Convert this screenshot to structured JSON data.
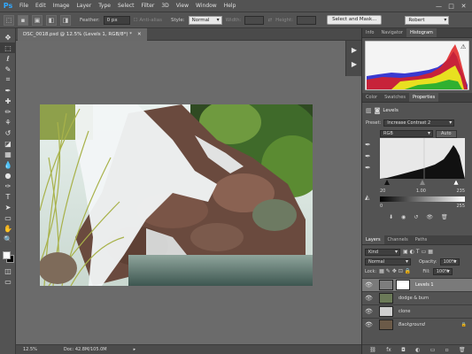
{
  "app": {
    "logo": "Ps"
  },
  "menu": [
    "File",
    "Edit",
    "Image",
    "Layer",
    "Type",
    "Select",
    "Filter",
    "3D",
    "View",
    "Window",
    "Help"
  ],
  "window_controls": [
    "—",
    "□",
    "✕"
  ],
  "options": {
    "feather_label": "Feather:",
    "feather_value": "0 px",
    "anti_alias_label": "Anti-alias",
    "style_label": "Style:",
    "style_value": "Normal",
    "width_label": "Width:",
    "height_label": "Height:",
    "select_mask_label": "Select and Mask...",
    "workspace_value": "Robert"
  },
  "tools": [
    "move-tool",
    "marquee-tool",
    "lasso-tool",
    "quick-select-tool",
    "crop-tool",
    "eyedropper-tool",
    "healing-brush-tool",
    "brush-tool",
    "clone-stamp-tool",
    "history-brush-tool",
    "eraser-tool",
    "gradient-tool",
    "blur-tool",
    "dodge-tool",
    "pen-tool",
    "type-tool",
    "path-select-tool",
    "rectangle-tool",
    "hand-tool",
    "zoom-tool"
  ],
  "tool_glyphs": [
    "✥",
    "⬚",
    "ℓ",
    "✎",
    "⌗",
    "✒",
    "✚",
    "✏",
    "⚘",
    "↺",
    "◪",
    "▦",
    "💧",
    "●",
    "✑",
    "T",
    "➤",
    "▭",
    "✋",
    "🔍"
  ],
  "document": {
    "tab_label": "DSC_0018.psd @ 12.5% (Levels 1, RGB/8*) *",
    "close": "✕"
  },
  "status": {
    "zoom": "12.5%",
    "doc_info": "Doc: 42.8M/105.0M",
    "arrow": "▸"
  },
  "histogram_panel": {
    "tabs": [
      "Info",
      "Navigator",
      "Histogram"
    ],
    "active": 2
  },
  "properties_panel": {
    "tabs": [
      "Color",
      "Swatches",
      "Properties"
    ],
    "active": 2,
    "title": "Levels",
    "preset_label": "Preset:",
    "preset_value": "Increase Contrast 2",
    "channel_value": "RGB",
    "auto_label": "Auto",
    "input_black": "20",
    "input_gray": "1.00",
    "input_white": "235",
    "output_black": "0",
    "output_white": "255"
  },
  "layers_panel": {
    "tabs": [
      "Layers",
      "Channels",
      "Paths"
    ],
    "active": 0,
    "filter_kind": "Kind",
    "blend_mode": "Normal",
    "opacity_label": "Opacity:",
    "opacity_value": "100%",
    "lock_label": "Lock:",
    "fill_label": "Fill:",
    "fill_value": "100%",
    "layers": [
      {
        "name": "Levels 1",
        "selected": true
      },
      {
        "name": "dodge & burn",
        "selected": false
      },
      {
        "name": "clone",
        "selected": false
      },
      {
        "name": "Background",
        "selected": false
      }
    ],
    "footer_icons": [
      "link-icon",
      "fx-icon",
      "mask-icon",
      "adjustment-icon",
      "folder-icon",
      "new-layer-icon",
      "trash-icon"
    ],
    "footer_glyphs": [
      "⛓",
      "fx",
      "◘",
      "◐",
      "▭",
      "▫",
      "🗑"
    ]
  },
  "colors": {
    "accent_blue": "#31a8ff",
    "panel_bg": "#535353",
    "canvas_bg": "#6b6b6b"
  }
}
